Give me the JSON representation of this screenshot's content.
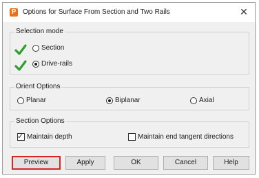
{
  "window": {
    "title": "Options for Surface From Section and Two Rails",
    "app_icon_letter": "P",
    "close_glyph": "✕"
  },
  "selection_mode": {
    "label": "Selection mode",
    "options": [
      {
        "label": "Section",
        "checked": false
      },
      {
        "label": "Drive-rails",
        "checked": true
      }
    ],
    "status_icon": "green-checkmark-icon",
    "status_color": "#2e9e2e"
  },
  "orient_options": {
    "label": "Orient Options",
    "options": [
      {
        "label": "Planar",
        "checked": false
      },
      {
        "label": "Biplanar",
        "checked": true
      },
      {
        "label": "Axial",
        "checked": false
      }
    ]
  },
  "section_options": {
    "label": "Section Options",
    "maintain_depth": {
      "label": "Maintain depth",
      "checked": true
    },
    "maintain_end_tangent": {
      "label": "Maintain end tangent directions",
      "checked": false
    }
  },
  "buttons": {
    "preview": "Preview",
    "apply": "Apply",
    "ok": "OK",
    "cancel": "Cancel",
    "help": "Help"
  },
  "highlight_color": "#d42525"
}
